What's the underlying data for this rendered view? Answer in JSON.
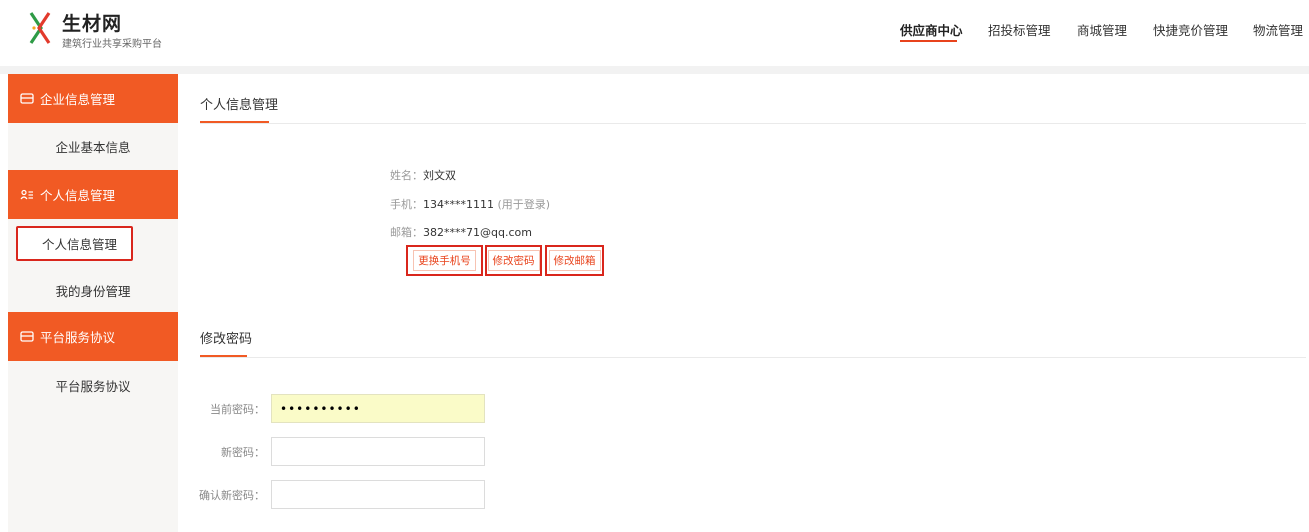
{
  "header": {
    "logo_title": "生材网",
    "logo_sub": "建筑行业共享采购平台",
    "nav": [
      {
        "label": "供应商中心",
        "active": true
      },
      {
        "label": "招投标管理",
        "active": false
      },
      {
        "label": "商城管理",
        "active": false
      },
      {
        "label": "快捷竞价管理",
        "active": false
      },
      {
        "label": "物流管理",
        "active": false
      }
    ]
  },
  "sidebar": {
    "sections": [
      {
        "title": "企业信息管理",
        "icon": "tray-icon",
        "items": [
          "企业基本信息"
        ]
      },
      {
        "title": "个人信息管理",
        "icon": "user-id-icon",
        "items": [
          "个人信息管理",
          "我的身份管理"
        ],
        "selected": "个人信息管理"
      },
      {
        "title": "平台服务协议",
        "icon": "tray-icon",
        "items": [
          "平台服务协议"
        ]
      }
    ]
  },
  "profile": {
    "section_title": "个人信息管理",
    "name_label": "姓名：",
    "name_value": "刘文双",
    "phone_label": "手机：",
    "phone_value": "134****1111",
    "phone_hint": "(用于登录)",
    "email_label": "邮箱：",
    "email_value": "382****71@qq.com",
    "buttons": {
      "change_phone": "更换手机号",
      "change_password": "修改密码",
      "change_email": "修改邮箱"
    }
  },
  "password_form": {
    "section_title": "修改密码",
    "current_label": "当前密码：",
    "current_value": "••••••••••",
    "new_label": "新密码：",
    "new_value": "",
    "confirm_label": "确认新密码：",
    "confirm_value": ""
  },
  "colors": {
    "accent": "#f15a24",
    "highlight_border": "#d9261c",
    "autofill_bg": "#fafbc8"
  }
}
